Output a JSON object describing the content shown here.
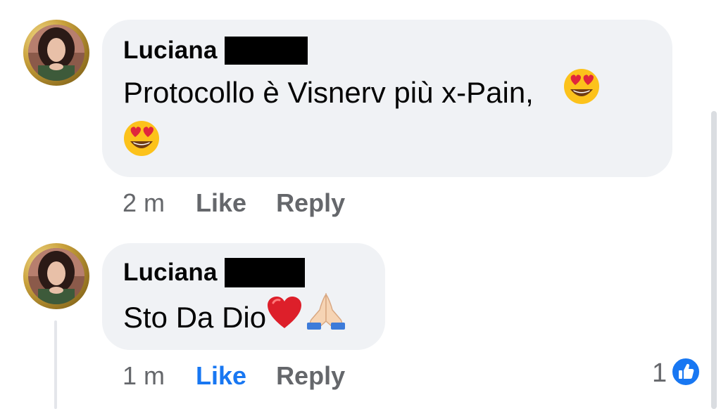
{
  "comments": [
    {
      "author": "Luciana",
      "text": "Protocollo è Visnerv più x-Pain,",
      "emojis": [
        "heart-eyes-emoji",
        "heart-eyes-emoji"
      ],
      "time": "2 m",
      "like_label": "Like",
      "reply_label": "Reply",
      "like_active": false
    },
    {
      "author": "Luciana",
      "text": "Sto Da Dio",
      "emojis": [
        "red-heart-emoji",
        "folded-hands-emoji"
      ],
      "time": "1 m",
      "like_label": "Like",
      "reply_label": "Reply",
      "like_active": true,
      "reaction_count": "1"
    }
  ],
  "colors": {
    "bubble": "#f0f2f5",
    "secondary_text": "#65676b",
    "accent": "#1877f2",
    "text": "#050505"
  },
  "icons": {
    "like_reaction": "thumbs-up-icon"
  }
}
